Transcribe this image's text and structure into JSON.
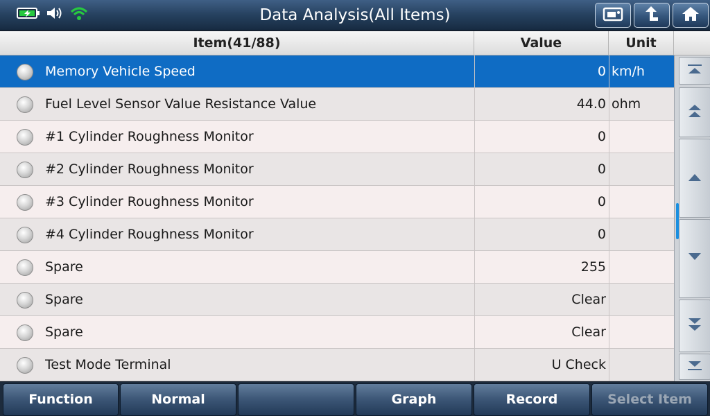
{
  "header": {
    "title": "Data Analysis(All Items)",
    "icons": [
      "battery-charging-icon",
      "speaker-icon",
      "wifi-icon",
      "screenshot-icon",
      "back-arrow-icon",
      "home-icon"
    ]
  },
  "table": {
    "columns": {
      "item": "Item(41/88)",
      "value": "Value",
      "unit": "Unit"
    },
    "rows": [
      {
        "name": "Memory Vehicle Speed",
        "value": "0",
        "unit": "km/h",
        "selected": true
      },
      {
        "name": "Fuel Level Sensor Value Resistance Value",
        "value": "44.0",
        "unit": "ohm"
      },
      {
        "name": "#1 Cylinder Roughness Monitor",
        "value": "0",
        "unit": ""
      },
      {
        "name": "#2 Cylinder Roughness Monitor",
        "value": "0",
        "unit": ""
      },
      {
        "name": "#3 Cylinder Roughness Monitor",
        "value": "0",
        "unit": ""
      },
      {
        "name": "#4 Cylinder Roughness Monitor",
        "value": "0",
        "unit": ""
      },
      {
        "name": "Spare",
        "value": "255",
        "unit": ""
      },
      {
        "name": "Spare",
        "value": "Clear",
        "unit": ""
      },
      {
        "name": "Spare",
        "value": "Clear",
        "unit": ""
      },
      {
        "name": "Test Mode Terminal",
        "value": "U Check",
        "unit": ""
      }
    ]
  },
  "footer": {
    "buttons": [
      {
        "label": "Function",
        "enabled": true
      },
      {
        "label": "Normal",
        "enabled": true
      },
      {
        "label": "",
        "enabled": true
      },
      {
        "label": "Graph",
        "enabled": true
      },
      {
        "label": "Record",
        "enabled": true
      },
      {
        "label": "Select Item",
        "enabled": false
      }
    ]
  },
  "colors": {
    "selected_row": "#0f6cc4",
    "scroll_thumb": "#1a8fe0",
    "wifi": "#27c93f",
    "battery": "#27c93f"
  }
}
